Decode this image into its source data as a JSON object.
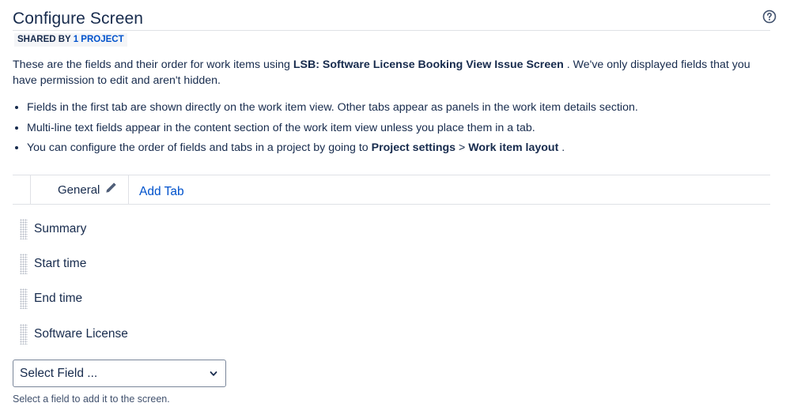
{
  "header": {
    "title": "Configure Screen",
    "shared_prefix": "SHARED BY ",
    "shared_link": "1 PROJECT",
    "help_icon": "question-circle-icon"
  },
  "description": {
    "part1": "These are the fields and their order for work items using ",
    "screen_name": "LSB: Software License Booking View Issue Screen",
    "part2": " . We've only displayed fields that you have permission to edit and aren't hidden."
  },
  "notes": [
    "Fields in the first tab are shown directly on the work item view. Other tabs appear as panels in the work item details section.",
    "Multi-line text fields appear in the content section of the work item view unless you place them in a tab."
  ],
  "note3": {
    "prefix": "You can configure the order of fields and tabs in a project by going to ",
    "settings": "Project settings",
    "separator": " > ",
    "layout": "Work item layout",
    "suffix": " ."
  },
  "tabs": {
    "general_label": "General",
    "edit_icon": "pencil-icon",
    "add_tab_label": "Add Tab"
  },
  "fields": [
    {
      "label": "Summary"
    },
    {
      "label": "Start time"
    },
    {
      "label": "End time"
    },
    {
      "label": "Software License"
    }
  ],
  "select": {
    "value": "Select Field ...",
    "hint": "Select a field to add it to the screen."
  },
  "colors": {
    "text": "#172b4d",
    "link": "#0052cc",
    "border": "#dfe1e6"
  }
}
